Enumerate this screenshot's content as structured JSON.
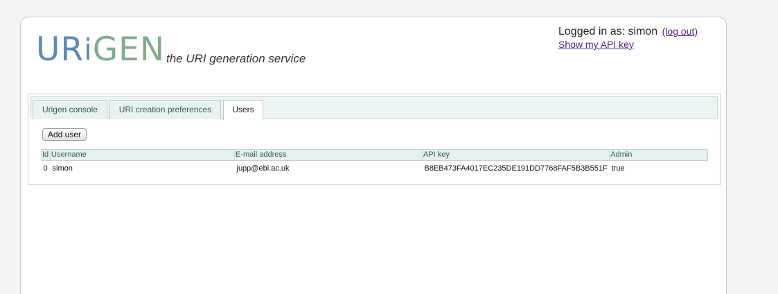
{
  "brand": {
    "logo_ur": "UR",
    "logo_i": "i",
    "logo_gen": "GEN",
    "tagline": "the URI generation service",
    "color_blue": "#5b8ab9",
    "color_green": "#7fac8a"
  },
  "account": {
    "logged_in_as": "Logged in as: simon",
    "logout": "(log out)",
    "api_key_link": "Show my API key"
  },
  "tabs": [
    {
      "label": "Urigen console",
      "active": false
    },
    {
      "label": "URI creation preferences",
      "active": false
    },
    {
      "label": "Users",
      "active": true
    }
  ],
  "users": {
    "add_button": "Add user",
    "columns": [
      "Id",
      "Username",
      "E-mail address",
      "API key",
      "Admin"
    ],
    "rows": [
      {
        "id": "0",
        "username": "simon",
        "email": "jupp@ebi.ac.uk",
        "api_key": "B8EB473FA4017EC235DE191DD7768FAF5B3B551F",
        "admin": "true"
      }
    ]
  }
}
